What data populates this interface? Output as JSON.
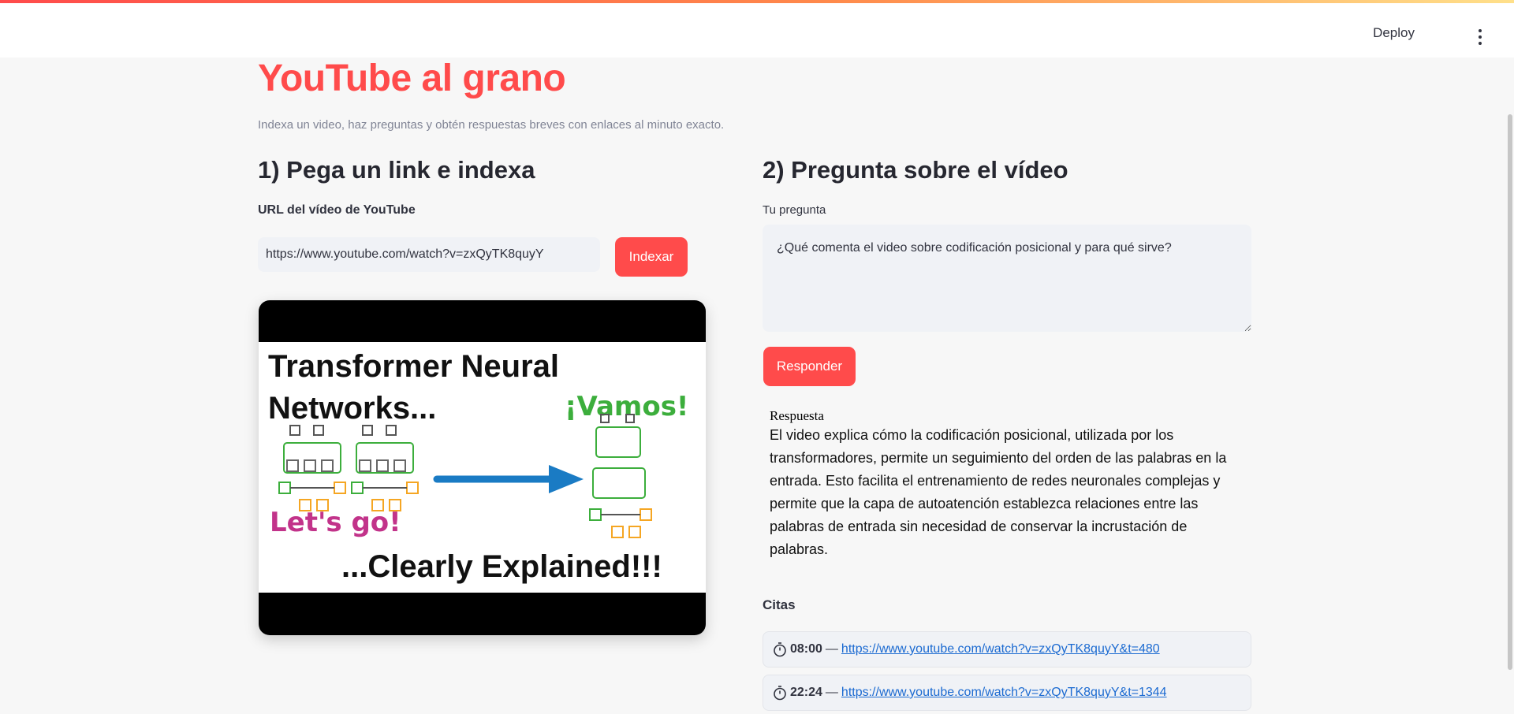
{
  "header": {
    "deploy_label": "Deploy"
  },
  "page": {
    "title": "YouTube al grano",
    "subtitle": "Indexa un video, haz preguntas y obtén respuestas breves con enlaces al minuto exacto."
  },
  "left": {
    "heading": "1) Pega un link e indexa",
    "url_label": "URL del vídeo de YouTube",
    "url_value": "https://www.youtube.com/watch?v=zxQyTK8quyY",
    "index_button": "Indexar",
    "video": {
      "line1": "Transformer Neural",
      "line2": "Networks...",
      "vamos": "¡Vamos!",
      "lets_go": "Let's go!",
      "clearly": "...Clearly Explained!!!"
    }
  },
  "right": {
    "heading": "2) Pregunta sobre el vídeo",
    "question_label": "Tu pregunta",
    "question_value": "¿Qué comenta el video sobre codificación posicional y para qué sirve?",
    "respond_button": "Responder",
    "answer_title": "Respuesta",
    "answer_text": "El video explica cómo la codificación posicional, utilizada por los transformadores, permite un seguimiento del orden de las palabras en la entrada. Esto facilita el entrenamiento de redes neuronales complejas y permite que la capa de autoatención establezca relaciones entre las palabras de entrada sin necesidad de conservar la incrustación de palabras.",
    "citations_label": "Citas",
    "citations": [
      {
        "time": "08:00",
        "url": "https://www.youtube.com/watch?v=zxQyTK8quyY&t=480"
      },
      {
        "time": "22:24",
        "url": "https://www.youtube.com/watch?v=zxQyTK8quyY&t=1344"
      }
    ]
  },
  "icons": {
    "kebab": "kebab-menu-icon",
    "stopwatch": "stopwatch-icon"
  },
  "colors": {
    "accent": "#ff4b4b",
    "link": "#1b6ad1",
    "input_bg": "#f0f2f6"
  }
}
